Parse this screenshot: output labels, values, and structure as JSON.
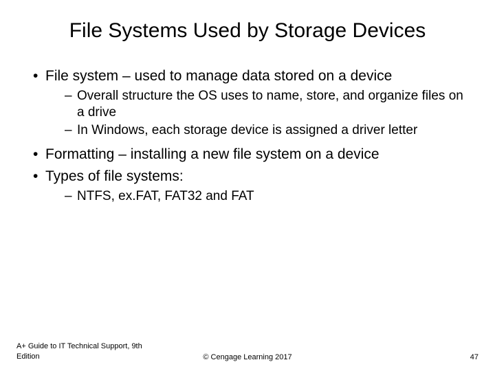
{
  "title": "File Systems Used by Storage Devices",
  "bullets": {
    "b1": "File system – used to manage data stored on a device",
    "b1_sub1": "Overall structure the OS uses to name, store, and organize files on a drive",
    "b1_sub2": "In Windows, each storage device is assigned a driver letter",
    "b2": "Formatting – installing a new file system on a device",
    "b3": "Types of file systems:",
    "b3_sub1": "NTFS, ex.FAT, FAT32 and FAT"
  },
  "footer": {
    "left": "A+ Guide to IT Technical Support, 9th Edition",
    "center": "© Cengage Learning 2017",
    "right": "47"
  }
}
